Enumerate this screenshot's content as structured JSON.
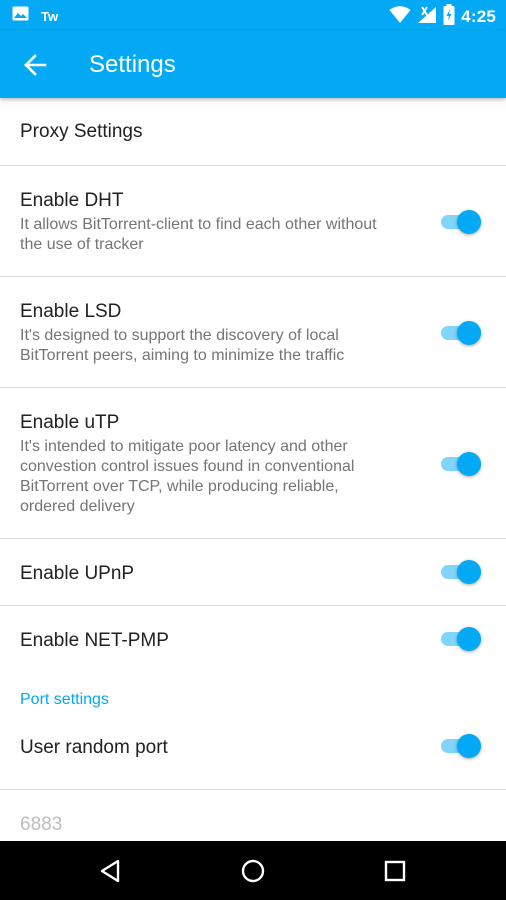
{
  "status_bar": {
    "time": "4:25",
    "left_icons": [
      "image-icon",
      "tw-icon"
    ],
    "tw_label": "Tw",
    "right_icons": [
      "wifi-icon",
      "signal-icon",
      "battery-icon"
    ]
  },
  "app_bar": {
    "title": "Settings",
    "back_icon": "arrow-back-icon"
  },
  "settings": {
    "proxy": {
      "title": "Proxy Settings"
    },
    "dht": {
      "title": "Enable DHT",
      "summary": "It allows BitTorrent-client to find each other without the use of tracker",
      "enabled": true
    },
    "lsd": {
      "title": "Enable LSD",
      "summary": "It's designed to support the discovery of local BitTorrent peers, aiming to minimize the traffic",
      "enabled": true
    },
    "utp": {
      "title": "Enable uTP",
      "summary": "It's intended to mitigate poor latency and other convestion control issues found in conventional BitTorrent over TCP, while producing reliable, ordered delivery",
      "enabled": true
    },
    "upnp": {
      "title": "Enable UPnP",
      "enabled": true
    },
    "natpmp": {
      "title": "Enable NET-PMP",
      "enabled": true
    },
    "port_section": {
      "label": "Port settings"
    },
    "random_port": {
      "title": "User random port",
      "enabled": true
    },
    "port_value": "6883"
  },
  "nav_bar": {
    "icons": [
      "back-triangle-icon",
      "home-circle-icon",
      "recents-square-icon"
    ]
  },
  "colors": {
    "primary": "#03a9f4",
    "switch_track": "#81d4fa",
    "divider": "#dcdcdc"
  }
}
